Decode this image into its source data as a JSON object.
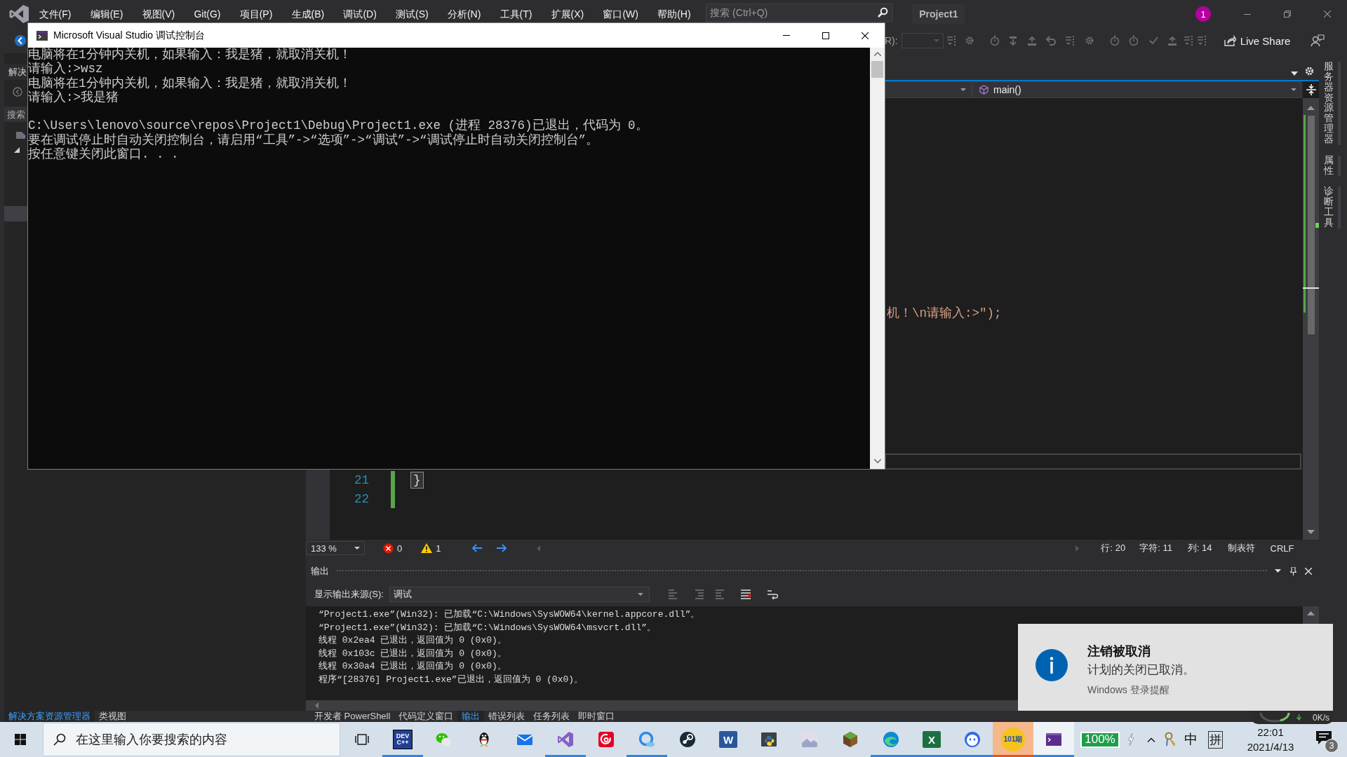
{
  "menu_bar": {
    "items": [
      "文件(F)",
      "编辑(E)",
      "视图(V)",
      "Git(G)",
      "项目(P)",
      "生成(B)",
      "调试(D)",
      "测试(S)",
      "分析(N)",
      "工具(T)",
      "扩展(X)",
      "窗口(W)",
      "帮助(H)"
    ],
    "search": {
      "placeholder": "搜索 (Ctrl+Q)"
    },
    "project": "Project1",
    "notification_count": "1"
  },
  "toolbar": {
    "config_label": "R):",
    "live_share": "Live Share"
  },
  "console": {
    "title": "Microsoft Visual Studio 调试控制台",
    "blocks": [
      [
        "电脑将在1分钟内关机，如果输入：我是猪，就取消关机！",
        "请输入:>wsz",
        "电脑将在1分钟内关机，如果输入：我是猪，就取消关机！",
        "请输入:>我是猪"
      ],
      [
        "C:\\Users\\lenovo\\source\\repos\\Project1\\Debug\\Project1.exe (进程 28376)已退出，代码为 0。",
        "要在调试停止时自动关闭控制台，请启用“工具”->“选项”->“调试”->“调试停止时自动关闭控制台”。",
        "按任意键关闭此窗口. . ."
      ]
    ]
  },
  "solution_explorer": {
    "title": "解决",
    "search": {
      "placeholder": "搜索"
    },
    "selected_row": true
  },
  "editor": {
    "function_scope": "main()",
    "cut_line": "机！\\n请输入:>\");",
    "lines": [
      {
        "number": "21",
        "code": "}",
        "changed": true,
        "brace_match": true
      },
      {
        "number": "22",
        "changed": true
      }
    ]
  },
  "editor_status": {
    "zoom": "133 %",
    "errors": "0",
    "warnings": "1",
    "line": "行: 20",
    "char": "字符: 11",
    "column": "列: 14",
    "indent": "制表符",
    "line_ending": "CRLF"
  },
  "output": {
    "title": "输出",
    "source_label": "显示输出来源(S):",
    "source": "调试",
    "lines": [
      "“Project1.exe”(Win32): 已加载“C:\\Windows\\SysWOW64\\kernel.appcore.dll”。",
      "“Project1.exe”(Win32): 已加载“C:\\Windows\\SysWOW64\\msvcrt.dll”。",
      "线程 0x2ea4 已退出，返回值为 0 (0x0)。",
      "线程 0x103c 已退出，返回值为 0 (0x0)。",
      "线程 0x30a4 已退出，返回值为 0 (0x0)。",
      "程序“[28376] Project1.exe”已退出，返回值为 0 (0x0)。"
    ]
  },
  "side_tabs": [
    "服务器资源管理器",
    "属性",
    "诊断工具"
  ],
  "left_tabs": [
    {
      "label": "解决方案资源管理器",
      "selected": true
    },
    {
      "label": "类视图",
      "selected": false
    }
  ],
  "bottom_tabs": [
    {
      "label": "开发者 PowerShell",
      "selected": false
    },
    {
      "label": "代码定义窗口",
      "selected": false
    },
    {
      "label": "输出",
      "selected": true
    },
    {
      "label": "错误列表",
      "selected": false
    },
    {
      "label": "任务列表",
      "selected": false
    },
    {
      "label": "即时窗口",
      "selected": false
    }
  ],
  "notification": {
    "title": "注销被取消",
    "message": "计划的关闭已取消。",
    "source": "Windows 登录提醒"
  },
  "net_speed": "0K/s",
  "taskbar": {
    "search": {
      "placeholder": "在这里输入你要搜索的内容"
    },
    "apps": [
      {
        "kind": "dev",
        "label": "DEV",
        "sublabel": "C++",
        "running": true,
        "selected": false,
        "flashing": false
      },
      {
        "kind": "chat",
        "running": false,
        "selected": false,
        "flashing": false
      },
      {
        "kind": "penguin",
        "running": false,
        "selected": false,
        "flashing": false
      },
      {
        "kind": "mail",
        "running": false,
        "selected": false,
        "flashing": false
      },
      {
        "kind": "ide",
        "running": true,
        "selected": false,
        "flashing": false
      },
      {
        "kind": "music",
        "running": false,
        "selected": false,
        "flashing": false
      },
      {
        "kind": "cloud",
        "running": true,
        "selected": false,
        "flashing": false
      },
      {
        "kind": "game",
        "running": false,
        "selected": false,
        "flashing": false
      },
      {
        "kind": "word",
        "label": "W",
        "running": false,
        "selected": false,
        "flashing": false
      },
      {
        "kind": "python",
        "running": false,
        "selected": false,
        "flashing": false
      },
      {
        "kind": "picture",
        "running": false,
        "selected": false,
        "flashing": false
      },
      {
        "kind": "block",
        "running": false,
        "selected": false,
        "flashing": false
      },
      {
        "kind": "edge",
        "running": true,
        "selected": false,
        "flashing": false
      },
      {
        "kind": "excel",
        "label": "X",
        "running": true,
        "selected": false,
        "flashing": false
      },
      {
        "kind": "face",
        "running": true,
        "selected": false,
        "flashing": false
      },
      {
        "kind": "disc",
        "label": "101期",
        "running": true,
        "selected": false,
        "flashing": true
      },
      {
        "kind": "terminal",
        "running": true,
        "selected": true,
        "flashing": false
      }
    ],
    "battery": "100%",
    "ime_mode": "中",
    "ime_name": "拼",
    "time": "22:01",
    "date": "2021/4/13",
    "notification_count": "3"
  }
}
